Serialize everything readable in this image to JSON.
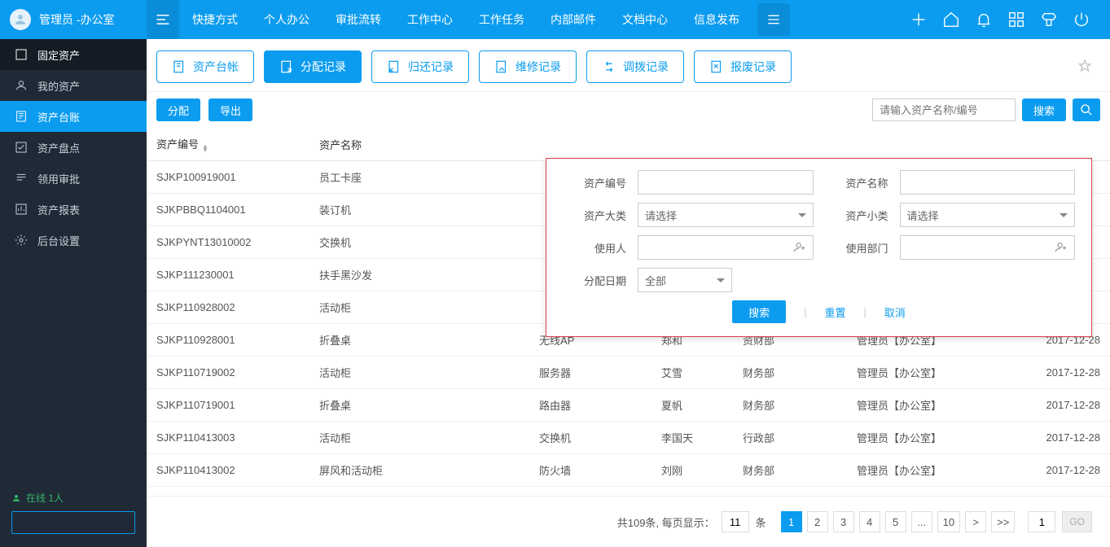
{
  "topbar": {
    "user_label": "管理员 -办公室",
    "nav": [
      "快捷方式",
      "个人办公",
      "审批流转",
      "工作中心",
      "工作任务",
      "内部邮件",
      "文档中心",
      "信息发布"
    ]
  },
  "sidebar": {
    "items": [
      {
        "label": "固定资产"
      },
      {
        "label": "我的资产"
      },
      {
        "label": "资产台账"
      },
      {
        "label": "资产盘点"
      },
      {
        "label": "领用审批"
      },
      {
        "label": "资产报表"
      },
      {
        "label": "后台设置"
      }
    ],
    "online_label": "在线 1人"
  },
  "tabs": [
    {
      "label": "资产台帐"
    },
    {
      "label": "分配记录"
    },
    {
      "label": "归还记录"
    },
    {
      "label": "维修记录"
    },
    {
      "label": "调拨记录"
    },
    {
      "label": "报废记录"
    }
  ],
  "toolbar": {
    "assign_label": "分配",
    "export_label": "导出",
    "search_placeholder": "请输入资产名称/编号",
    "search_label": "搜索"
  },
  "table": {
    "columns": [
      "资产编号",
      "资产名称",
      "",
      "",
      "",
      "",
      "",
      ""
    ],
    "rows": [
      {
        "c0": "SJKP100919001",
        "c1": "员工卡座"
      },
      {
        "c0": "SJKPBBQ1104001",
        "c1": "装订机"
      },
      {
        "c0": "SJKPYNT13010002",
        "c1": "交换机"
      },
      {
        "c0": "SJKP111230001",
        "c1": "扶手黑沙发"
      },
      {
        "c0": "SJKP110928002",
        "c1": "活动柜"
      },
      {
        "c0": "SJKP110928001",
        "c1": "折叠桌",
        "c2": "无线AP",
        "c3": "郑和",
        "c4": "资财部",
        "c5": "管理员【办公室】",
        "c6": "2017-12-28"
      },
      {
        "c0": "SJKP110719002",
        "c1": "活动柜",
        "c2": "服务器",
        "c3": "艾雪",
        "c4": "财务部",
        "c5": "管理员【办公室】",
        "c6": "2017-12-28"
      },
      {
        "c0": "SJKP110719001",
        "c1": "折叠桌",
        "c2": "路由器",
        "c3": "夏帆",
        "c4": "财务部",
        "c5": "管理员【办公室】",
        "c6": "2017-12-28"
      },
      {
        "c0": "SJKP110413003",
        "c1": "活动柜",
        "c2": "交换机",
        "c3": "李国天",
        "c4": "行政部",
        "c5": "管理员【办公室】",
        "c6": "2017-12-28"
      },
      {
        "c0": "SJKP110413002",
        "c1": "屏风和活动柜",
        "c2": "防火墙",
        "c3": "刘刚",
        "c4": "财务部",
        "c5": "管理员【办公室】",
        "c6": "2017-12-28"
      }
    ]
  },
  "search_panel": {
    "asset_code_label": "资产编号",
    "asset_name_label": "资产名称",
    "category_label": "资产大类",
    "subcategory_label": "资产小类",
    "select_placeholder": "请选择",
    "user_label": "使用人",
    "dept_label": "使用部门",
    "date_label": "分配日期",
    "date_value": "全部",
    "btn_search": "搜索",
    "btn_reset": "重置",
    "btn_cancel": "取消"
  },
  "pagination": {
    "summary_prefix": "共109条, 每页显示：",
    "per_page": "11",
    "unit": "条",
    "pages": [
      "1",
      "2",
      "3",
      "4",
      "5",
      "...",
      "10",
      ">",
      ">>"
    ],
    "goto_value": "1",
    "go_label": "GO"
  }
}
